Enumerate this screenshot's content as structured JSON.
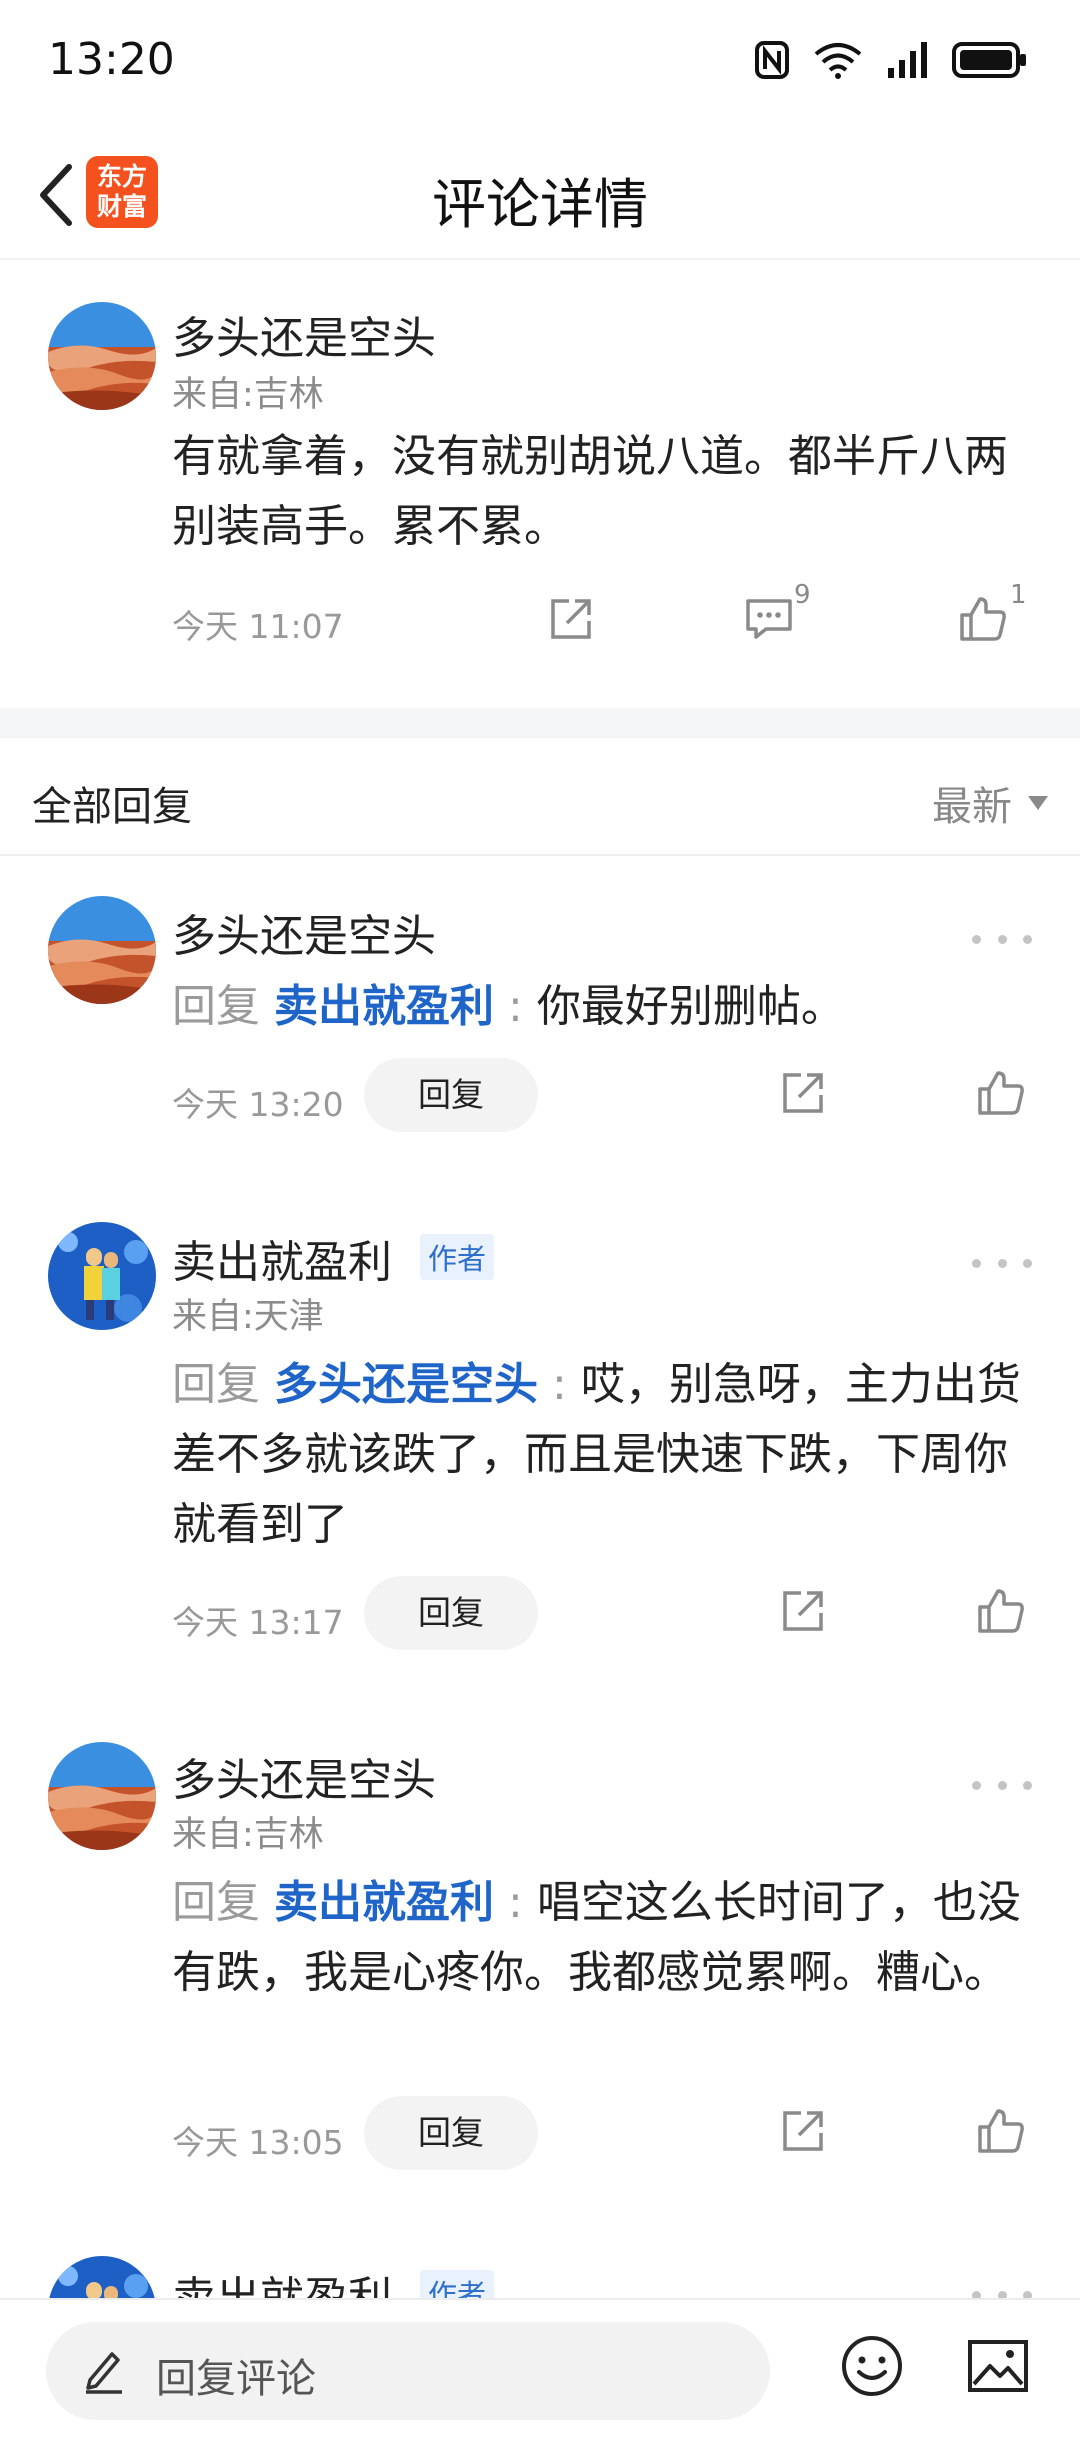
{
  "status_bar": {
    "time": "13:20",
    "icons": [
      "nfc-icon",
      "wifi-icon",
      "signal-icon",
      "battery-icon"
    ]
  },
  "nav": {
    "title": "评论详情",
    "brand_logo_text": "东方财富",
    "brand_color": "#f4511e"
  },
  "main_comment": {
    "username": "多头还是空头",
    "location": "来自:吉林",
    "content": "有就拿着，没有就别胡说八道。都半斤八两别装高手。累不累。",
    "time": "今天 11:07",
    "comment_count": "9",
    "like_count": "1"
  },
  "replies_header": {
    "title": "全部回复",
    "sort_label": "最新"
  },
  "replies": [
    {
      "username": "多头还是空头",
      "reply_prefix": "回复",
      "reply_target": "卖出就盈利",
      "separator": ":",
      "content": "你最好别删帖。",
      "time": "今天 13:20",
      "reply_button": "回复"
    },
    {
      "username": "卖出就盈利",
      "author_badge": "作者",
      "location": "来自:天津",
      "reply_prefix": "回复",
      "reply_target": "多头还是空头",
      "separator": ":",
      "content": "哎，别急呀，主力出货差不多就该跌了，而且是快速下跌，下周你就看到了",
      "time": "今天 13:17",
      "reply_button": "回复"
    },
    {
      "username": "多头还是空头",
      "location": "来自:吉林",
      "reply_prefix": "回复",
      "reply_target": "卖出就盈利",
      "separator": ":",
      "content": "唱空这么长时间了，也没有跌，我是心疼你。我都感觉累啊。糟心。",
      "time": "今天 13:05",
      "reply_button": "回复"
    },
    {
      "username": "卖出就盈利",
      "author_badge": "作者"
    }
  ],
  "bottom_bar": {
    "input_placeholder": "回复评论"
  },
  "colors": {
    "link_blue": "#1f64c8",
    "badge_blue": "#2f6fcc",
    "muted_gray": "#999999"
  }
}
